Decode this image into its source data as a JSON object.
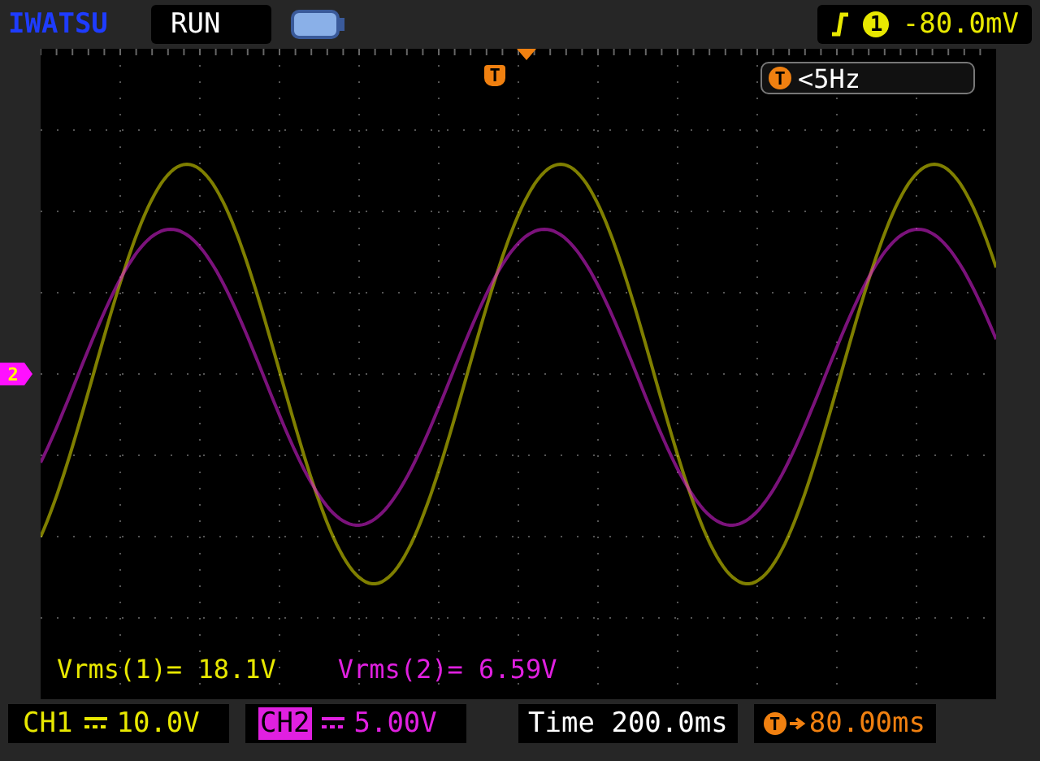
{
  "header": {
    "brand": "IWATSU",
    "run_state": "RUN",
    "trigger_source": "1",
    "trigger_level": "-80.0mV"
  },
  "screen": {
    "trigger_marker": "T",
    "trigger_freq_badge": "T",
    "trigger_freq": "<5Hz",
    "channel_marker": "2",
    "measurements": [
      {
        "text": "Vrms(1)= 18.1V",
        "color": "#e8e800"
      },
      {
        "text": "Vrms(2)= 6.59V",
        "color": "#e020e0"
      }
    ]
  },
  "footer": {
    "channels": [
      {
        "name": "CH1",
        "scale": "10.0V",
        "selected": false,
        "color": "#e8e800"
      },
      {
        "name": "CH2",
        "scale": "5.00V",
        "selected": true,
        "color": "#e020e0"
      }
    ],
    "timebase_label": "Time",
    "timebase": "200.0ms",
    "trigger_badge": "T",
    "trigger_offset": "80.00ms"
  }
}
